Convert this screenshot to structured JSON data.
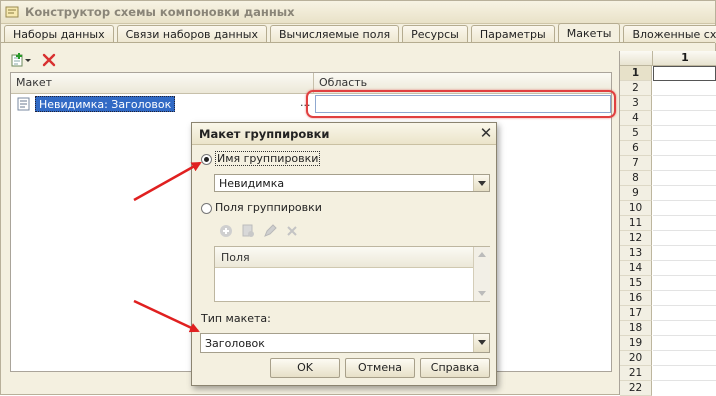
{
  "window": {
    "title": "Конструктор схемы компоновки данных"
  },
  "tabs": [
    {
      "label": "Наборы данных"
    },
    {
      "label": "Связи наборов данных"
    },
    {
      "label": "Вычисляемые поля"
    },
    {
      "label": "Ресурсы"
    },
    {
      "label": "Параметры"
    },
    {
      "label": "Макеты",
      "active": true
    },
    {
      "label": "Вложенные схемы"
    }
  ],
  "toolbar": {
    "add_icon": "add-layout-icon",
    "delete_icon": "delete-icon"
  },
  "table": {
    "headers": {
      "layout": "Макет",
      "area": "Область"
    },
    "rows": [
      {
        "layout": "Невидимка: Заголовок",
        "dots": "...",
        "area": ""
      }
    ]
  },
  "sheet": {
    "column": "1",
    "rows": [
      "1",
      "2",
      "3",
      "4",
      "5",
      "6",
      "7",
      "8",
      "9",
      "10",
      "11",
      "12",
      "13",
      "14",
      "15",
      "16",
      "17",
      "18",
      "19",
      "20",
      "21",
      "22"
    ]
  },
  "dialog": {
    "title": "Макет группировки",
    "grouping_name_label": "Имя группировки",
    "grouping_name_value": "Невидимка",
    "grouping_fields_label": "Поля группировки",
    "fields_header": "Поля",
    "layout_type_label": "Тип макета:",
    "layout_type_value": "Заголовок",
    "buttons": {
      "ok": "OK",
      "cancel": "Отмена",
      "help": "Справка"
    }
  },
  "colors": {
    "selection": "#316ac5",
    "highlight": "#e04040",
    "arrow": "#e02020"
  }
}
